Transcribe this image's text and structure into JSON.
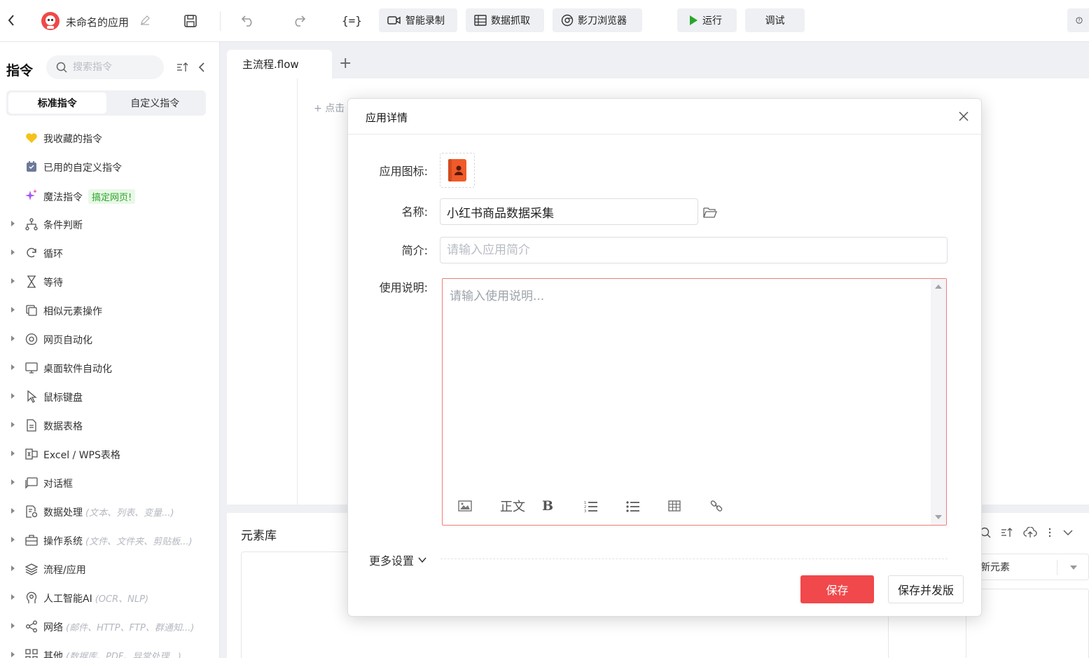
{
  "topbar": {
    "app_name": "未命名的应用",
    "smart_record": "智能录制",
    "data_scrape": "数据抓取",
    "browser": "影刀浏览器",
    "run": "运行",
    "debug": "调试"
  },
  "sidebar": {
    "title": "指令",
    "search_placeholder": "搜索指令",
    "tabs": [
      "标准指令",
      "自定义指令"
    ],
    "favorites": "我收藏的指令",
    "used_custom": "已用的自定义指令",
    "magic": "魔法指令",
    "magic_badge": "搞定网页!",
    "items": [
      {
        "label": "条件判断",
        "hint": ""
      },
      {
        "label": "循环",
        "hint": ""
      },
      {
        "label": "等待",
        "hint": ""
      },
      {
        "label": "相似元素操作",
        "hint": ""
      },
      {
        "label": "网页自动化",
        "hint": ""
      },
      {
        "label": "桌面软件自动化",
        "hint": ""
      },
      {
        "label": "鼠标键盘",
        "hint": ""
      },
      {
        "label": "数据表格",
        "hint": ""
      },
      {
        "label": "Excel / WPS表格",
        "hint": ""
      },
      {
        "label": "对话框",
        "hint": ""
      },
      {
        "label": "数据处理",
        "hint": "(文本、列表、变量...)"
      },
      {
        "label": "操作系统",
        "hint": "(文件、文件夹、剪贴板...)"
      },
      {
        "label": "流程/应用",
        "hint": ""
      },
      {
        "label": "人工智能AI",
        "hint": "(OCR、NLP)"
      },
      {
        "label": "网络",
        "hint": "(邮件、HTTP、FTP、群通知...)"
      },
      {
        "label": "其他",
        "hint": "(数据库、PDF、异常处理...)"
      }
    ]
  },
  "main": {
    "file_tab": "主流程.flow",
    "add_hint": "点击",
    "element_lib": "元素库",
    "right_select": "新元素"
  },
  "modal": {
    "title": "应用详情",
    "icon_label": "应用图标:",
    "name_label": "名称:",
    "name_value": "小红书商品数据采集",
    "desc_label": "简介:",
    "desc_placeholder": "请输入应用简介",
    "usage_label": "使用说明:",
    "usage_placeholder": "请输入使用说明...",
    "toolbar_text": "正文",
    "toolbar_bold": "B",
    "more_settings": "更多设置",
    "save": "保存",
    "save_publish": "保存并发版"
  },
  "colors": {
    "accent": "#f0484b",
    "run_green": "#2aa52a"
  }
}
